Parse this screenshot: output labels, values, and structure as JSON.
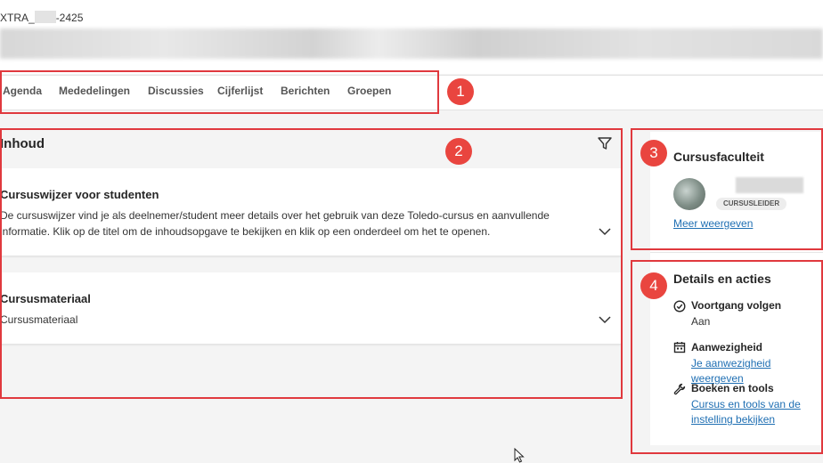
{
  "header": {
    "course_code_prefix": "XTRA_",
    "course_code_suffix": "-2425"
  },
  "nav": {
    "items": [
      {
        "label": "Agenda"
      },
      {
        "label": "Mededelingen"
      },
      {
        "label": "Discussies"
      },
      {
        "label": "Cijferlijst"
      },
      {
        "label": "Berichten"
      },
      {
        "label": "Groepen"
      }
    ]
  },
  "annotations": [
    "1",
    "2",
    "3",
    "4"
  ],
  "content": {
    "title": "Inhoud",
    "items": [
      {
        "title": "Cursuswijzer voor studenten",
        "description_line1": "De cursuswijzer vind je als deelnemer/student meer details over het gebruik van deze Toledo-cursus en aanvullende",
        "description_line2": "informatie. Klik op de titel om de inhoudsopgave te bekijken en klik op een onderdeel om het te openen."
      },
      {
        "title": "Cursusmateriaal",
        "description_line1": "Cursusmateriaal"
      }
    ]
  },
  "faculty": {
    "title": "Cursusfaculteit",
    "role": "CURSUSLEIDER",
    "more_link": "Meer weergeven"
  },
  "details": {
    "title": "Details en acties",
    "items": [
      {
        "label": "Voortgang volgen",
        "value": "Aan",
        "icon": "check-circle-icon"
      },
      {
        "label": "Aanwezigheid",
        "value": "Je aanwezigheid weergeven",
        "icon": "calendar-icon"
      },
      {
        "label": "Boeken en tools",
        "value_line1": "Cursus en tools van de",
        "value_line2": "instelling bekijken",
        "icon": "wrench-icon"
      }
    ]
  },
  "colors": {
    "accent_link": "#1f6fb3",
    "annotation_red": "#e0393e"
  }
}
